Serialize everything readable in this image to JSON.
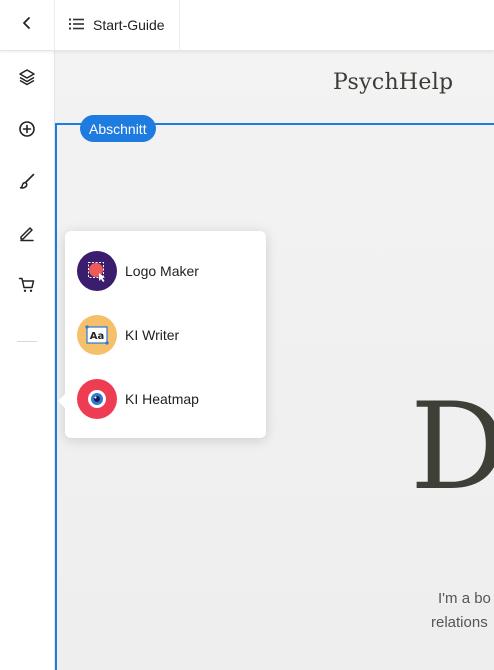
{
  "topbar": {
    "back_icon": "chevron-left-icon",
    "guide_icon": "list-icon",
    "guide_label": "Start-Guide"
  },
  "sidebar": {
    "items": [
      {
        "name": "layers",
        "icon": "layers-icon"
      },
      {
        "name": "add",
        "icon": "plus-circle-icon"
      },
      {
        "name": "design",
        "icon": "paintbrush-icon"
      },
      {
        "name": "edit",
        "icon": "pencil-icon"
      },
      {
        "name": "shop",
        "icon": "cart-icon"
      },
      {
        "name": "ai-tools",
        "icon": "robot-icon",
        "active": true
      }
    ]
  },
  "canvas": {
    "brand": "PsychHelp",
    "section_badge": "Abschnitt",
    "hero_letter": "D",
    "bio_line1": "I'm a bo",
    "bio_line2": "relations"
  },
  "ai_menu": {
    "items": [
      {
        "label": "Logo Maker",
        "icon": "logo-maker-icon"
      },
      {
        "label": "KI Writer",
        "icon": "text-writer-icon"
      },
      {
        "label": "KI Heatmap",
        "icon": "eye-heatmap-icon"
      }
    ]
  },
  "colors": {
    "accent_blue": "#1e7be0",
    "ai_red": "#ee3d52",
    "logo_maker_bg": "#3b1d6e",
    "writer_bg": "#f6c06a",
    "heatmap_bg": "#ee3d52"
  }
}
